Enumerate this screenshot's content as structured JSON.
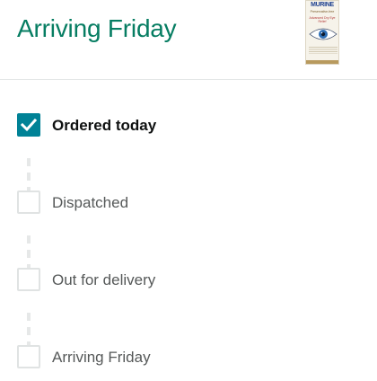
{
  "header": {
    "title": "Arriving Friday",
    "product": {
      "brand": "MURINE",
      "line1": "Preservative-free",
      "line2": "Advanced Dry Eye Relief",
      "accent_color": "#1c3f8f",
      "icon": "eye-icon"
    }
  },
  "steps": [
    {
      "label": "Ordered today",
      "status": "done"
    },
    {
      "label": "Dispatched",
      "status": "pending"
    },
    {
      "label": "Out for delivery",
      "status": "pending"
    },
    {
      "label": "Arriving Friday",
      "status": "pending"
    }
  ],
  "colors": {
    "title": "#067d62",
    "check": "#008296",
    "pending_border": "#e0e3e3"
  }
}
